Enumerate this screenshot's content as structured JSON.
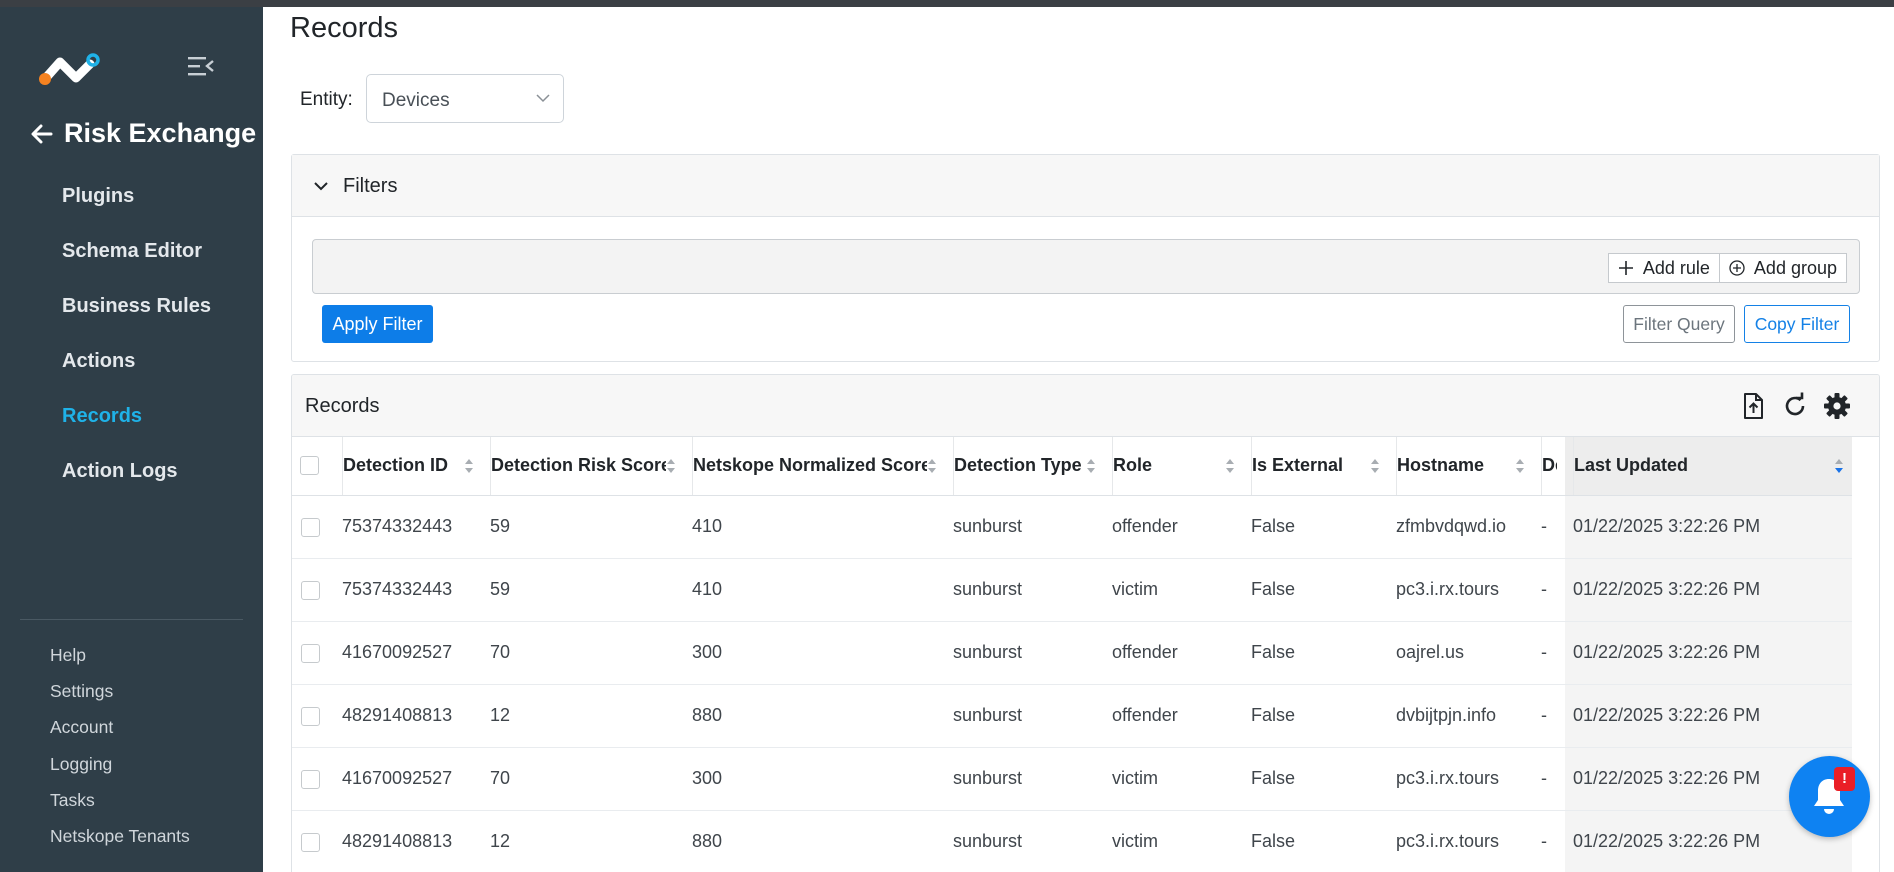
{
  "sidebar": {
    "app_title": "Risk Exchange",
    "nav_items": [
      {
        "label": "Plugins"
      },
      {
        "label": "Schema Editor"
      },
      {
        "label": "Business Rules"
      },
      {
        "label": "Actions"
      },
      {
        "label": "Records",
        "active": true
      },
      {
        "label": "Action Logs"
      }
    ],
    "bottom_items": [
      {
        "label": "Help"
      },
      {
        "label": "Settings"
      },
      {
        "label": "Account"
      },
      {
        "label": "Logging"
      },
      {
        "label": "Tasks"
      },
      {
        "label": "Netskope Tenants"
      }
    ],
    "accent_color": "#1fb2e8"
  },
  "page": {
    "title": "Records",
    "entity_label": "Entity:",
    "entity_value": "Devices"
  },
  "filters": {
    "title": "Filters",
    "add_rule": "Add rule",
    "add_group": "Add group",
    "apply": "Apply Filter",
    "filter_query": "Filter Query",
    "copy_filter": "Copy Filter"
  },
  "records": {
    "title": "Records",
    "icons": [
      "export-icon",
      "refresh-icon",
      "settings-gear-icon"
    ],
    "columns": [
      "Detection ID",
      "Detection Risk Score",
      "Netskope Normalized Score",
      "Detection Type",
      "Role",
      "Is External",
      "Hostname",
      "De",
      "Last Updated"
    ],
    "sorted_column": "Last Updated",
    "rows": [
      [
        "75374332443",
        "59",
        "410",
        "sunburst",
        "offender",
        "False",
        "zfmbvdqwd.io",
        "-",
        "01/22/2025 3:22:26 PM"
      ],
      [
        "75374332443",
        "59",
        "410",
        "sunburst",
        "victim",
        "False",
        "pc3.i.rx.tours",
        "-",
        "01/22/2025 3:22:26 PM"
      ],
      [
        "41670092527",
        "70",
        "300",
        "sunburst",
        "offender",
        "False",
        "oajrel.us",
        "-",
        "01/22/2025 3:22:26 PM"
      ],
      [
        "48291408813",
        "12",
        "880",
        "sunburst",
        "offender",
        "False",
        "dvbijtpjn.info",
        "-",
        "01/22/2025 3:22:26 PM"
      ],
      [
        "41670092527",
        "70",
        "300",
        "sunburst",
        "victim",
        "False",
        "pc3.i.rx.tours",
        "-",
        "01/22/2025 3:22:26 PM"
      ],
      [
        "48291408813",
        "12",
        "880",
        "sunburst",
        "victim",
        "False",
        "pc3.i.rx.tours",
        "-",
        "01/22/2025 3:22:26 PM"
      ]
    ]
  },
  "notifications": {
    "badge": "!",
    "color": "#0e82f2"
  }
}
